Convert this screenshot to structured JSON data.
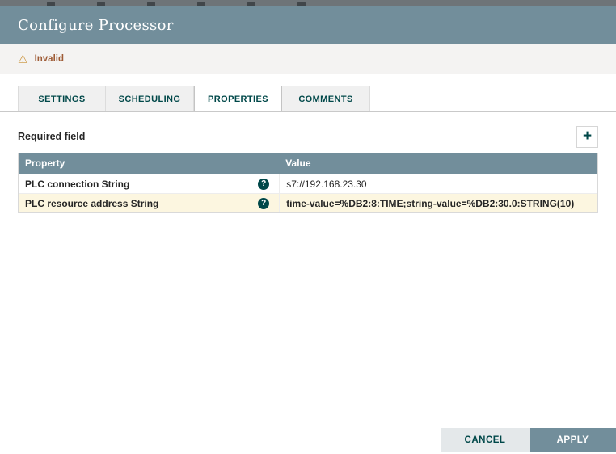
{
  "dialog": {
    "title": "Configure Processor",
    "status_bar": {
      "label": "Invalid"
    },
    "tabs": [
      {
        "label": "SETTINGS"
      },
      {
        "label": "SCHEDULING"
      },
      {
        "label": "PROPERTIES"
      },
      {
        "label": "COMMENTS"
      }
    ],
    "active_tab": "PROPERTIES",
    "properties_tab": {
      "required_field_label": "Required field",
      "table": {
        "headers": {
          "property": "Property",
          "value": "Value"
        },
        "rows": [
          {
            "property": "PLC connection String",
            "value": "s7://192.168.23.30",
            "highlighted": false
          },
          {
            "property": "PLC resource address String",
            "value": "time-value=%DB2:8:TIME;string-value=%DB2:30.0:STRING(10)",
            "highlighted": true
          }
        ]
      }
    },
    "footer": {
      "cancel_label": "CANCEL",
      "apply_label": "APPLY"
    }
  },
  "icons": {
    "warning": "⚠",
    "help": "?",
    "add": "+"
  },
  "colors": {
    "header": "#728e9b",
    "accent": "#004849",
    "invalid_text": "#9e5b35",
    "warning_icon": "#c98f33",
    "highlight_row": "#fcf6e0"
  }
}
